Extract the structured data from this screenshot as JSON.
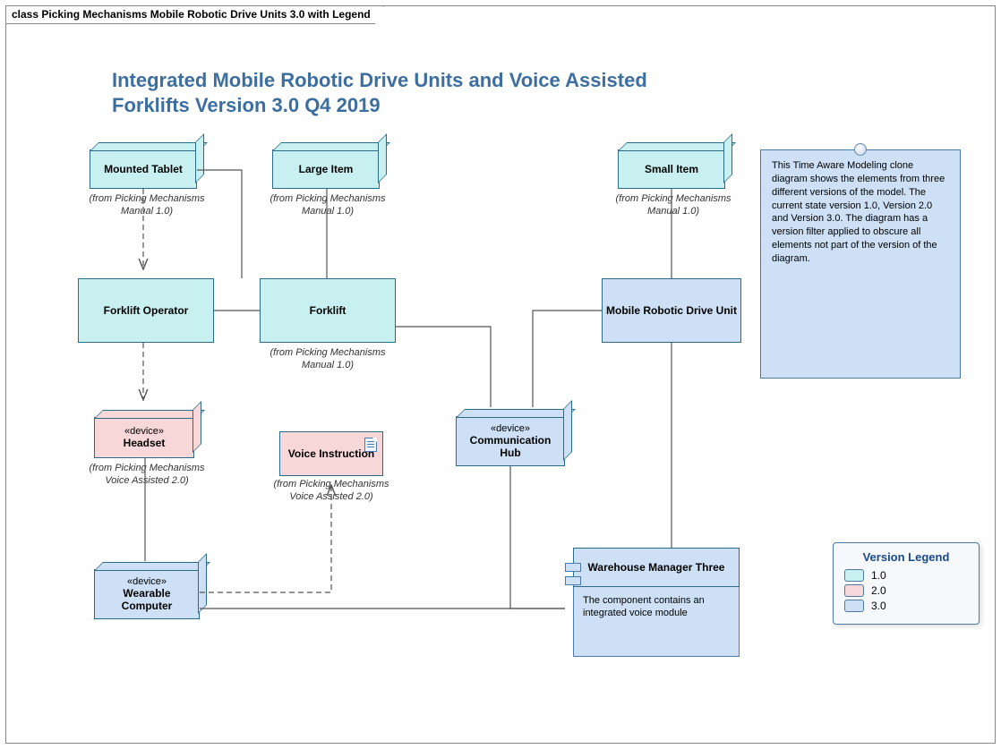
{
  "tab_label": "class Picking Mechanisms Mobile Robotic Drive Units 3.0  with Legend",
  "title": "Integrated Mobile Robotic Drive Units and Voice Assisted Forklifts Version 3.0 Q4 2019",
  "note_text": "This Time Aware Modeling clone diagram shows the elements from three different versions of the model. The current state version 1.0, Version 2.0 and Version 3.0. The diagram has a version filter applied to obscure all elements not part of the  version of the diagram.",
  "legend": {
    "title": "Version Legend",
    "items": [
      "1.0",
      "2.0",
      "3.0"
    ]
  },
  "nodes": {
    "mounted_tablet": {
      "label": "Mounted Tablet",
      "from": "(from Picking Mechanisms Manual 1.0)"
    },
    "large_item": {
      "label": "Large Item",
      "from": "(from Picking Mechanisms Manual 1.0)"
    },
    "small_item": {
      "label": "Small Item",
      "from": "(from Picking Mechanisms Manual 1.0)"
    },
    "forklift_operator": {
      "label": "Forklift Operator"
    },
    "forklift": {
      "label": "Forklift",
      "from": "(from Picking Mechanisms Manual 1.0)"
    },
    "mrdu": {
      "label": "Mobile Robotic Drive Unit"
    },
    "headset": {
      "stereo": "«device»",
      "label": "Headset",
      "from": "(from Picking Mechanisms Voice Assisted 2.0)"
    },
    "voice_instruction": {
      "label": "Voice Instruction",
      "from": "(from Picking Mechanisms Voice Assisted 2.0)"
    },
    "comm_hub": {
      "stereo": "«device»",
      "label": "Communication Hub"
    },
    "wearable": {
      "stereo": "«device»",
      "label": "Wearable Computer"
    },
    "wm3": {
      "label": "Warehouse Manager Three",
      "desc": "The component contains an integrated voice module"
    }
  }
}
